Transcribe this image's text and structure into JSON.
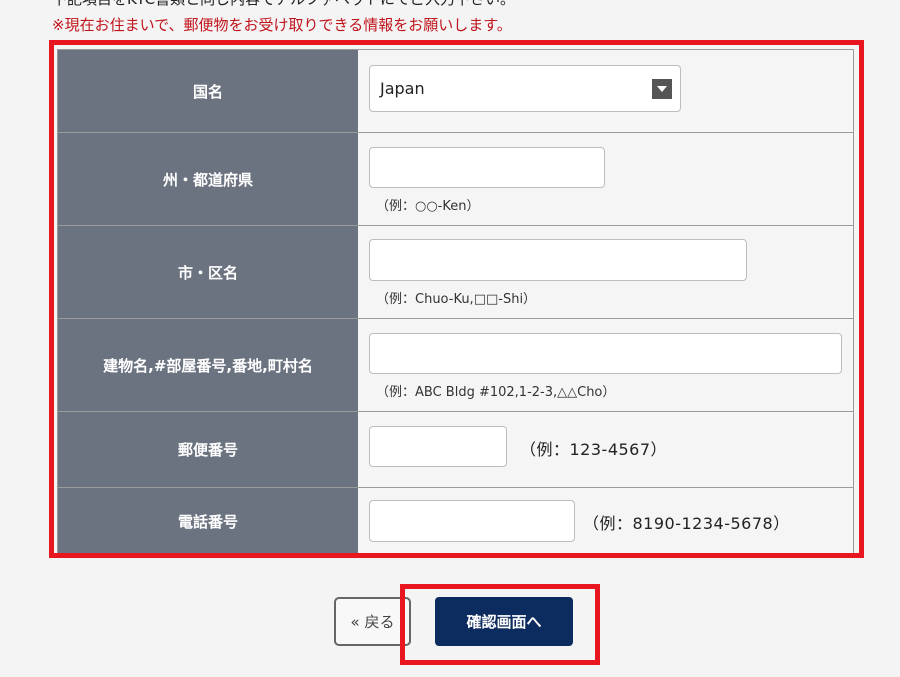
{
  "header": {
    "instruction": "下記項目をKYC書類と同じ内容でアルファベットにてご入力下さい。",
    "notice": "※現在お住まいで、郵便物をお受け取りできる情報をお願いします。"
  },
  "form": {
    "country": {
      "label": "国名",
      "value": "Japan"
    },
    "state": {
      "label": "州・都道府県",
      "hint": "（例：○○-Ken）"
    },
    "city": {
      "label": "市・区名",
      "hint": "（例：Chuo-Ku,□□-Shi）"
    },
    "building": {
      "label": "建物名,#部屋番号,番地,町村名",
      "hint": "（例：ABC Bldg #102,1-2-3,△△Cho）"
    },
    "postal": {
      "label": "郵便番号",
      "hint": "（例：123-4567）"
    },
    "phone": {
      "label": "電話番号",
      "hint": "（例：8190-1234-5678）"
    }
  },
  "buttons": {
    "back": "« 戻る",
    "confirm": "確認画面へ"
  },
  "colors": {
    "highlight": "#e8171f",
    "header_cell": "#6c7380",
    "confirm_button": "#0c2b5e",
    "notice_text": "#c0141c"
  }
}
